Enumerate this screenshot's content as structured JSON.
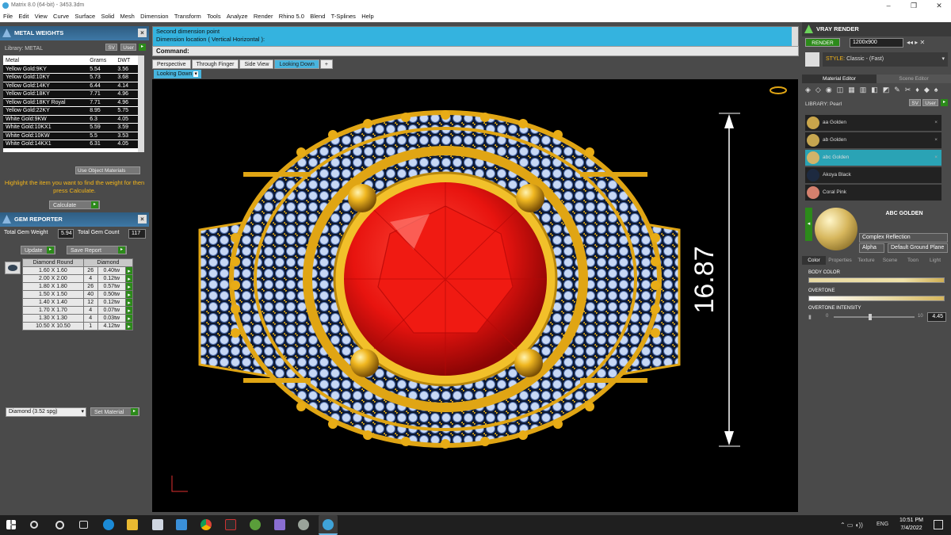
{
  "window": {
    "title": "Matrix 8.0 (64-bit) - 3453.3dm",
    "minimize": "–",
    "maximize": "❐",
    "close": "✕"
  },
  "menu": [
    "File",
    "Edit",
    "View",
    "Curve",
    "Surface",
    "Solid",
    "Mesh",
    "Dimension",
    "Transform",
    "Tools",
    "Analyze",
    "Render",
    "Rhino 5.0",
    "Blend",
    "T-Splines",
    "Help"
  ],
  "metal": {
    "title": "METAL WEIGHTS",
    "library_label": "Library: METAL",
    "btn_sv": "SV",
    "btn_user": "User",
    "columns": [
      "Metal",
      "Grams",
      "DWT"
    ],
    "rows": [
      [
        "Yellow Gold:9KY",
        "5.54",
        "3.56"
      ],
      [
        "Yellow Gold:10KY",
        "5.73",
        "3.68"
      ],
      [
        "Yellow Gold:14KY",
        "6.44",
        "4.14"
      ],
      [
        "Yellow Gold:18KY",
        "7.71",
        "4.96"
      ],
      [
        "Yellow Gold:18KY Royal",
        "7.71",
        "4.96"
      ],
      [
        "Yellow Gold:22KY",
        "8.95",
        "5.75"
      ],
      [
        "White Gold:9KW",
        "6.3",
        "4.05"
      ],
      [
        "White Gold:10KX1",
        "5.59",
        "3.59"
      ],
      [
        "White Gold:10KW",
        "5.5",
        "3.53"
      ],
      [
        "White Gold:14KX1",
        "6.31",
        "4.05"
      ]
    ],
    "use_object_materials": "Use Object Materials",
    "hint": "Highlight the item you want to find the weight for then press Calculate.",
    "calculate": "Calculate"
  },
  "gem": {
    "title": "GEM REPORTER",
    "total_weight_label": "Total Gem Weight",
    "total_weight": "5.94",
    "total_count_label": "Total Gem Count",
    "total_count": "117",
    "update": "Update",
    "save_report": "Save Report",
    "columns": [
      "Diamond Round",
      "Diamond"
    ],
    "rows": [
      [
        "1.60 X 1.60",
        "26",
        "0.40tw"
      ],
      [
        "2.00 X 2.00",
        "4",
        "0.12tw"
      ],
      [
        "1.80 X 1.80",
        "26",
        "0.57tw"
      ],
      [
        "1.50 X 1.50",
        "40",
        "0.50tw"
      ],
      [
        "1.40 X 1.40",
        "12",
        "0.12tw"
      ],
      [
        "1.70 X 1.70",
        "4",
        "0.07tw"
      ],
      [
        "1.30 X 1.30",
        "4",
        "0.03tw"
      ],
      [
        "10.50 X 10.50",
        "1",
        "4.12tw"
      ]
    ],
    "material_select": "Diamond   (3.52 spg)",
    "set_material": "Set Material"
  },
  "command": {
    "line1": "Second dimension point",
    "line2": "Dimension location ( Vertical  Horizontal ):",
    "label": "Command:"
  },
  "tabs": [
    "Perspective",
    "Through Finger",
    "Side View",
    "Looking Down"
  ],
  "active_view": "Looking Down",
  "dimension": "16.87",
  "vray": {
    "title": "VRAY RENDER",
    "render": "RENDER",
    "resolution": "1200x900",
    "style_label": "STYLE:",
    "style_value": "Classic - (Fast)",
    "tab_material": "Material Editor",
    "tab_scene": "Scene Editor",
    "library_label": "LIBRARY: Pearl",
    "btn_sv": "SV",
    "btn_user": "User",
    "materials": [
      {
        "name": "aa Golden",
        "color": "#c9a54b"
      },
      {
        "name": "ab Golden",
        "color": "#c6a650"
      },
      {
        "name": "abc Golden",
        "color": "#d1b46a"
      },
      {
        "name": "Akoya Black",
        "color": "#1d2a40"
      },
      {
        "name": "Coral Pink",
        "color": "#d4806d"
      }
    ],
    "selected_name": "ABC GOLDEN",
    "reflection": "Complex Reflection",
    "alpha": "Alpha",
    "ground": "Default Ground Plane",
    "subtabs": [
      "Color",
      "Properties",
      "Texture",
      "Scene",
      "Toon",
      "Light"
    ],
    "body_color": "BODY COLOR",
    "overtone": "OVERTONE",
    "overtone_intensity": "OVERTONE INTENSITY",
    "intensity_min": "0",
    "intensity_max": "10",
    "intensity_value": "4.45",
    "intensity_level": 0.445
  },
  "taskbar": {
    "lang": "ENG",
    "time": "10:51 PM",
    "date": "7/4/2022"
  },
  "colors": {
    "accent": "#34b3df",
    "gold": "#e0a514",
    "ruby": "#e8140f",
    "panel": "#4a4a4a"
  }
}
